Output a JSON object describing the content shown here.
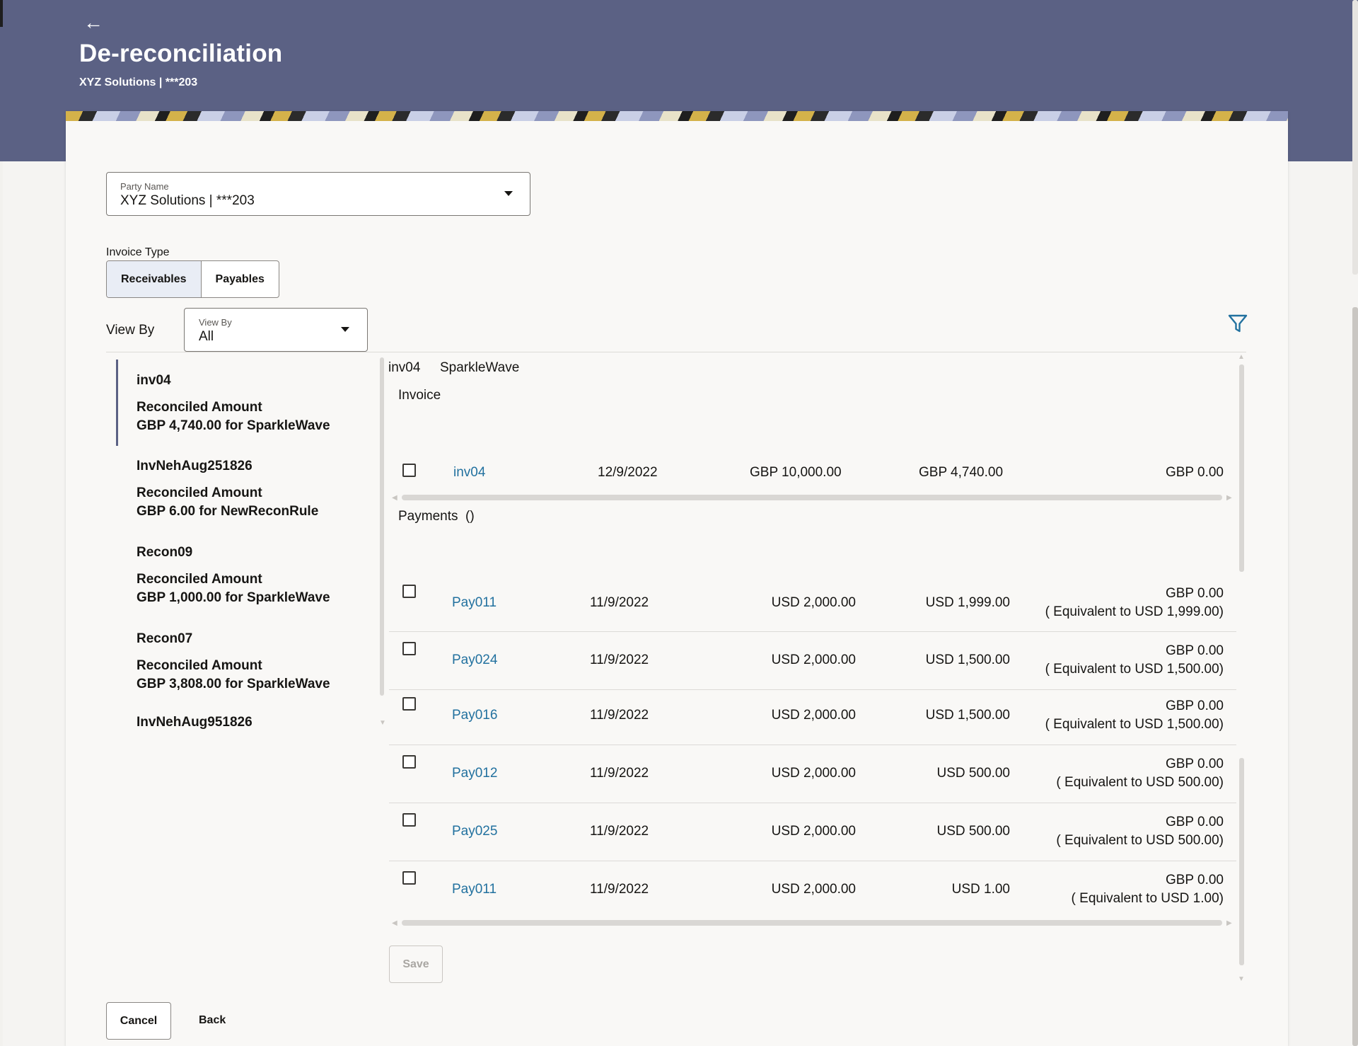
{
  "header": {
    "back_icon": "left-arrow-icon",
    "title": "De-reconciliation",
    "subtitle": "XYZ Solutions | ***203"
  },
  "party_name": {
    "label": "Party Name",
    "value": "XYZ Solutions | ***203"
  },
  "invoice_type": {
    "label": "Invoice Type",
    "options": [
      "Receivables",
      "Payables"
    ],
    "selected": "Receivables"
  },
  "view_by": {
    "label": "View By",
    "select_label": "View By",
    "value": "All"
  },
  "filter_icon": "filter-icon",
  "side_list": [
    {
      "title": "inv04",
      "amount_label": "Reconciled Amount",
      "amount": "GBP 4,740.00 for SparkleWave"
    },
    {
      "title": "InvNehAug251826",
      "amount_label": "Reconciled Amount",
      "amount": "GBP 6.00 for NewReconRule"
    },
    {
      "title": "Recon09",
      "amount_label": "Reconciled Amount",
      "amount": "GBP 1,000.00 for SparkleWave"
    },
    {
      "title": "Recon07",
      "amount_label": "Reconciled Amount",
      "amount": "GBP 3,808.00 for SparkleWave"
    },
    {
      "title": "InvNehAug951826"
    }
  ],
  "detail": {
    "invoice_id": "inv04",
    "party": "SparkleWave",
    "invoice_heading": "Invoice",
    "invoice_row": {
      "id": "inv04",
      "date": "12/9/2022",
      "amount": "GBP 10,000.00",
      "reconciled": "GBP 4,740.00",
      "outstanding": "GBP 0.00"
    },
    "payments_heading": "Payments",
    "payments_count": "()",
    "payments": [
      {
        "id": "Pay011",
        "date": "11/9/2022",
        "amount": "USD 2,000.00",
        "reconciled": "USD 1,999.00",
        "outstanding": "GBP 0.00",
        "equivalent": "( Equivalent to USD 1,999.00)"
      },
      {
        "id": "Pay024",
        "date": "11/9/2022",
        "amount": "USD 2,000.00",
        "reconciled": "USD 1,500.00",
        "outstanding": "GBP 0.00",
        "equivalent": "( Equivalent to USD 1,500.00)"
      },
      {
        "id": "Pay016",
        "date": "11/9/2022",
        "amount": "USD 2,000.00",
        "reconciled": "USD 1,500.00",
        "outstanding": "GBP 0.00",
        "equivalent": "( Equivalent to USD 1,500.00)"
      },
      {
        "id": "Pay012",
        "date": "11/9/2022",
        "amount": "USD 2,000.00",
        "reconciled": "USD 500.00",
        "outstanding": "GBP 0.00",
        "equivalent": "( Equivalent to USD 500.00)"
      },
      {
        "id": "Pay025",
        "date": "11/9/2022",
        "amount": "USD 2,000.00",
        "reconciled": "USD 500.00",
        "outstanding": "GBP 0.00",
        "equivalent": "( Equivalent to USD 500.00)"
      },
      {
        "id": "Pay011",
        "date": "11/9/2022",
        "amount": "USD 2,000.00",
        "reconciled": "USD 1.00",
        "outstanding": "GBP 0.00",
        "equivalent": "( Equivalent to USD 1.00)"
      }
    ],
    "save_label": "Save"
  },
  "footer": {
    "cancel_label": "Cancel",
    "back_label": "Back"
  },
  "colors": {
    "header_bg": "#5b6184",
    "link": "#22719f",
    "card_bg": "#f9f8f6"
  }
}
